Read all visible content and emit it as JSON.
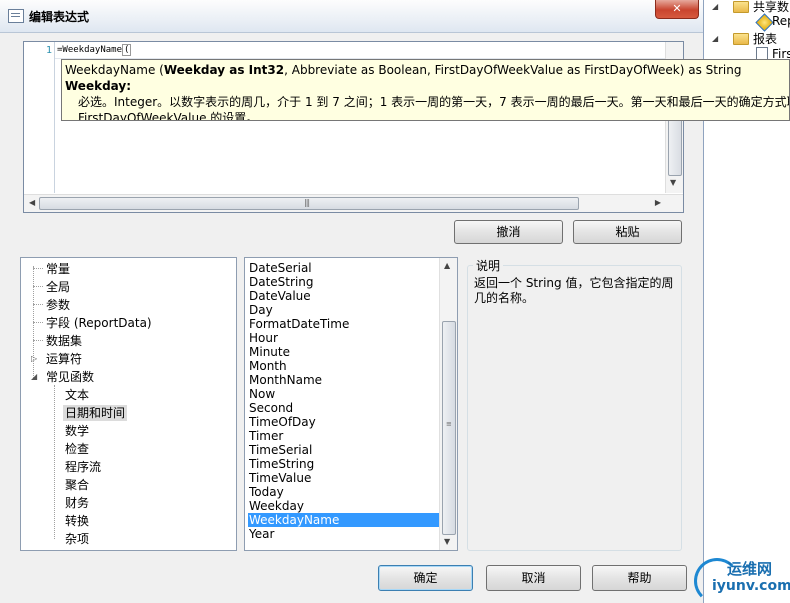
{
  "window": {
    "title": "编辑表达式",
    "close_label": "✕"
  },
  "editor": {
    "line_number": "1",
    "code_text": "=WeekdayName",
    "code_brace": "("
  },
  "tooltip": {
    "fn": "WeekdayName (",
    "param1": "Weekday as Int32",
    "rest": ", Abbreviate as Boolean, FirstDayOfWeekValue as FirstDayOfWeek) as String",
    "param_name": "Weekday:",
    "desc_line1": "必选。Integer。以数字表示的周几，介于 1 到 7 之间；1 表示一周的第一天，7 表示一周的最后一天。第一天和最后一天的确定方式取决于",
    "desc_line2": "FirstDayOfWeekValue 的设置。"
  },
  "buttons": {
    "undo": "撤消",
    "paste": "粘贴",
    "ok": "确定",
    "cancel": "取消",
    "help": "帮助"
  },
  "categories": [
    "常量",
    "全局",
    "参数",
    "字段 (ReportData)",
    "数据集",
    "运算符",
    "常见函数"
  ],
  "subcategories": [
    "文本",
    "日期和时间",
    "数学",
    "检查",
    "程序流",
    "聚合",
    "财务",
    "转换",
    "杂项"
  ],
  "functions": [
    "DateSerial",
    "DateString",
    "DateValue",
    "Day",
    "FormatDateTime",
    "Hour",
    "Minute",
    "Month",
    "MonthName",
    "Now",
    "Second",
    "TimeOfDay",
    "Timer",
    "TimeSerial",
    "TimeString",
    "TimeValue",
    "Today",
    "Weekday",
    "WeekdayName",
    "Year"
  ],
  "selected_function": "WeekdayName",
  "description": {
    "legend": "说明",
    "text": "返回一个 String 值，它包含指定的周几的名称。"
  },
  "solution_explorer": {
    "shared_data": "共享数",
    "report_item": "Rep",
    "reports": "报表",
    "first_item": "Firs"
  },
  "watermark": {
    "cn": "运维网",
    "url": "iyunv.com"
  }
}
